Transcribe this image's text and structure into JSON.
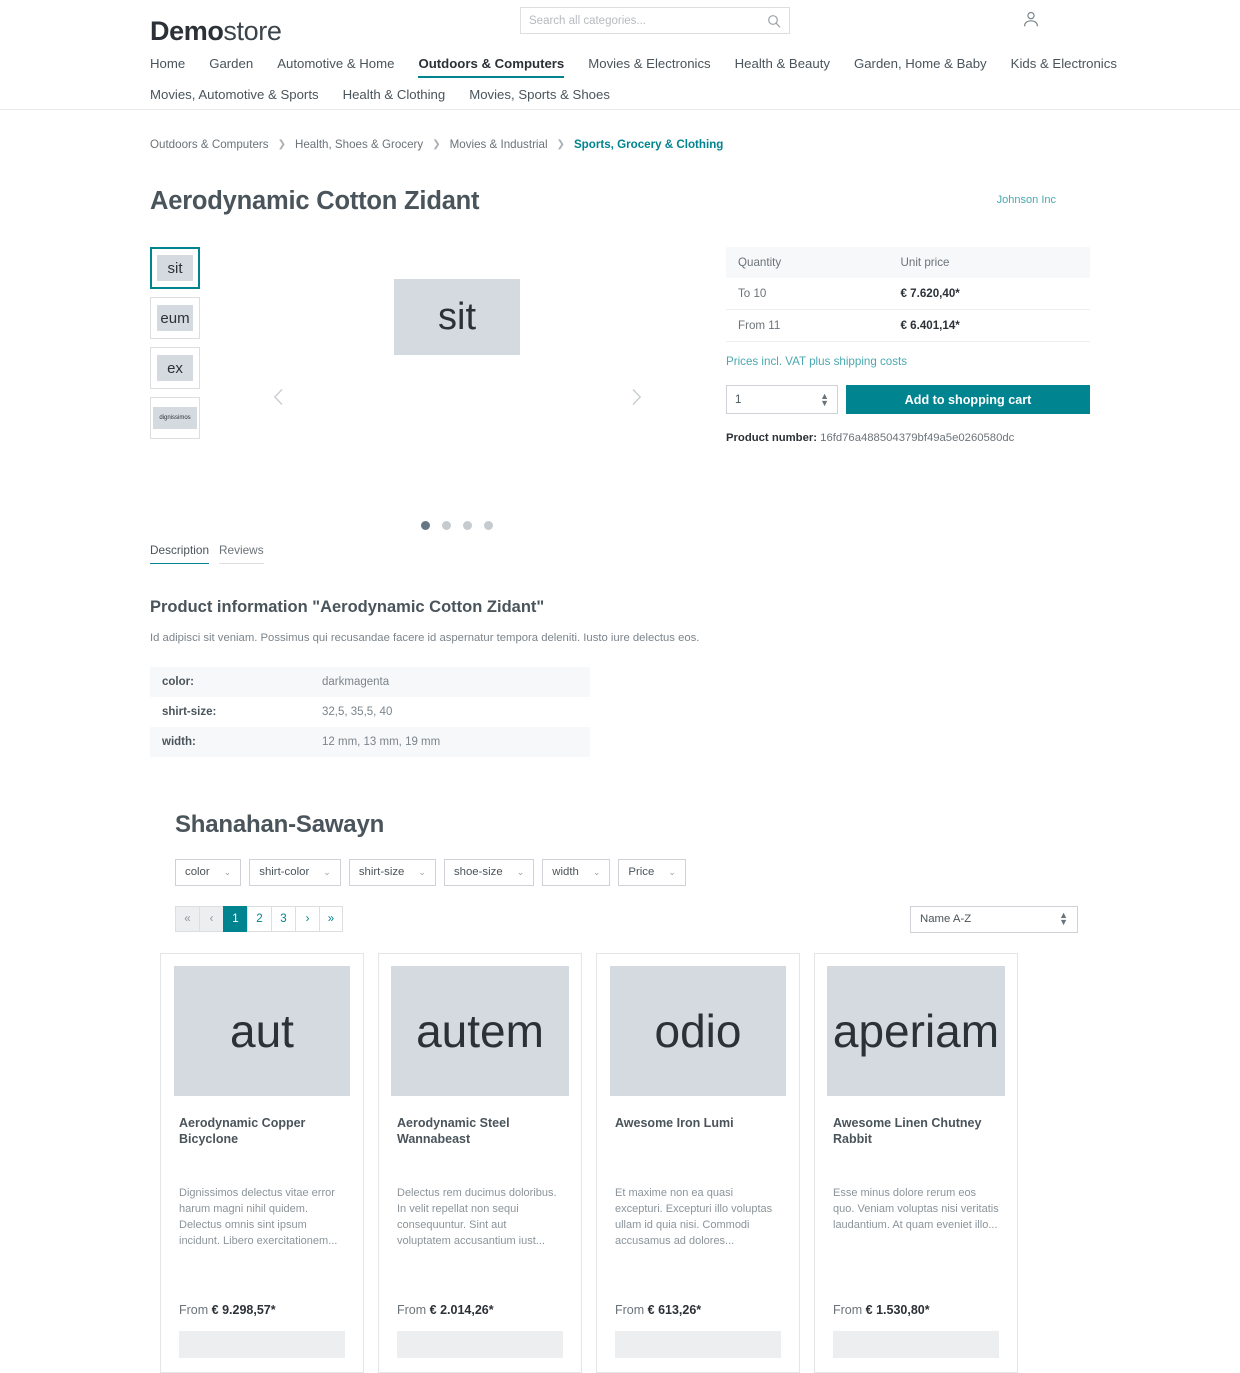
{
  "header": {
    "logo_bold": "Demo",
    "logo_light": "store",
    "search_placeholder": "Search all categories...",
    "search_value": "",
    "nav_row1": [
      {
        "label": "Home",
        "active": false
      },
      {
        "label": "Garden",
        "active": false
      },
      {
        "label": "Automotive & Home",
        "active": false
      },
      {
        "label": "Outdoors & Computers",
        "active": true
      },
      {
        "label": "Movies & Electronics",
        "active": false
      },
      {
        "label": "Health & Beauty",
        "active": false
      },
      {
        "label": "Garden, Home & Baby",
        "active": false
      },
      {
        "label": "Kids & Electronics",
        "active": false
      }
    ],
    "nav_row2": [
      {
        "label": "Movies, Automotive & Sports",
        "active": false
      },
      {
        "label": "Health & Clothing",
        "active": false
      },
      {
        "label": "Movies, Sports & Shoes",
        "active": false
      }
    ]
  },
  "breadcrumb": [
    {
      "label": "Outdoors & Computers",
      "active": false
    },
    {
      "label": "Health, Shoes & Grocery",
      "active": false
    },
    {
      "label": "Movies & Industrial",
      "active": false
    },
    {
      "label": "Sports, Grocery & Clothing",
      "active": true
    }
  ],
  "product": {
    "title": "Aerodynamic Cotton Zidant",
    "manufacturer": "Johnson Inc",
    "thumbnails": [
      {
        "label": "sit",
        "active": true
      },
      {
        "label": "eum",
        "active": false
      },
      {
        "label": "ex",
        "active": false
      },
      {
        "label": "dignissimos",
        "active": false
      }
    ],
    "main_image_label": "sit",
    "dots": [
      true,
      false,
      false,
      false
    ],
    "price_table": {
      "header_quantity": "Quantity",
      "header_unit_price": "Unit price",
      "rows": [
        {
          "quantity": "To 10",
          "price": "€ 7.620,40*"
        },
        {
          "quantity": "From 11",
          "price": "€ 6.401,14*"
        }
      ]
    },
    "vat_note": "Prices incl. VAT plus shipping costs",
    "quantity_value": "1",
    "add_to_cart_label": "Add to shopping cart",
    "product_number_label": "Product number:",
    "product_number_value": "16fd76a488504379bf49a5e0260580dc"
  },
  "tabs": [
    {
      "label": "Description",
      "active": true
    },
    {
      "label": "Reviews",
      "active": false
    }
  ],
  "description": {
    "heading": "Product information \"Aerodynamic Cotton Zidant\"",
    "text": "Id adipisci sit veniam. Possimus qui recusandae facere id aspernatur tempora deleniti. Iusto iure delectus eos.",
    "properties": [
      {
        "key": "color:",
        "value": "darkmagenta"
      },
      {
        "key": "shirt-size:",
        "value": "32,5, 35,5, 40"
      },
      {
        "key": "width:",
        "value": "12 mm, 13 mm, 19 mm"
      }
    ]
  },
  "listing": {
    "title": "Shanahan-Sawayn",
    "filters": [
      {
        "label": "color"
      },
      {
        "label": "shirt-color"
      },
      {
        "label": "shirt-size"
      },
      {
        "label": "shoe-size"
      },
      {
        "label": "width"
      },
      {
        "label": "Price"
      }
    ],
    "pagination": [
      {
        "label": "«",
        "type": "nav"
      },
      {
        "label": "‹",
        "type": "nav"
      },
      {
        "label": "1",
        "type": "page",
        "active": true
      },
      {
        "label": "2",
        "type": "page",
        "active": false
      },
      {
        "label": "3",
        "type": "page",
        "active": false
      },
      {
        "label": "›",
        "type": "page"
      },
      {
        "label": "»",
        "type": "page"
      }
    ],
    "sort_value": "Name A-Z",
    "cards": [
      {
        "image_label": "aut",
        "image_overflow": false,
        "name": "Aerodynamic Copper Bicyclone",
        "description": "Dignissimos delectus vitae error harum magni nihil quidem. Delectus omnis sint ipsum incidunt. Libero exercitationem...",
        "price_prefix": "From",
        "price": "€ 9.298,57*"
      },
      {
        "image_label": "autem",
        "image_overflow": true,
        "name": "Aerodynamic Steel Wannabeast",
        "description": "Delectus rem ducimus doloribus. In velit repellat non sequi consequuntur. Sint aut voluptatem accusantium iust...",
        "price_prefix": "From",
        "price": "€ 2.014,26*"
      },
      {
        "image_label": "odio",
        "image_overflow": false,
        "name": "Awesome Iron Lumi",
        "description": "Et maxime non ea quasi excepturi. Excepturi illo voluptas ullam id quia nisi. Commodi accusamus ad dolores...",
        "price_prefix": "From",
        "price": "€ 613,26*"
      },
      {
        "image_label": "aperiam",
        "image_overflow": true,
        "name": "Awesome Linen Chutney Rabbit",
        "description": "Esse minus dolore rerum eos quo. Veniam voluptas nisi veritatis laudantium. At quam eveniet illo...",
        "price_prefix": "From",
        "price": "€ 1.530,80*"
      }
    ]
  },
  "colors": {
    "accent": "#008490",
    "text": "#4a545b",
    "muted": "#7b848b",
    "placeholder_bg": "#d4dae0"
  }
}
